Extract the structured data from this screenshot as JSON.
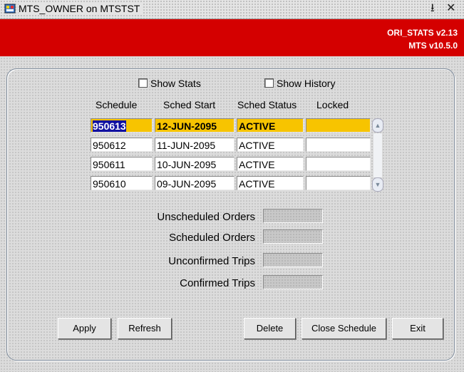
{
  "window": {
    "title": "MTS_OWNER on MTSTST",
    "controls": {
      "minimize": "⭳",
      "close": "✕"
    }
  },
  "header": {
    "version_primary": "ORI_STATS v2.13",
    "version_secondary": "MTS v10.5.0",
    "color": "#d40000"
  },
  "options": {
    "show_stats": {
      "label": "Show Stats",
      "checked": false
    },
    "show_history": {
      "label": "Show History",
      "checked": false
    }
  },
  "grid": {
    "columns": [
      "Schedule",
      "Sched Start",
      "Sched Status",
      "Locked"
    ],
    "rows": [
      {
        "schedule": "950613",
        "start": "12-JUN-2095",
        "status": "ACTIVE",
        "locked": "",
        "selected": true
      },
      {
        "schedule": "950612",
        "start": "11-JUN-2095",
        "status": "ACTIVE",
        "locked": ""
      },
      {
        "schedule": "950611",
        "start": "10-JUN-2095",
        "status": "ACTIVE",
        "locked": ""
      },
      {
        "schedule": "950610",
        "start": "09-JUN-2095",
        "status": "ACTIVE",
        "locked": ""
      }
    ],
    "highlight_color": "#f7c400"
  },
  "stats": {
    "unscheduled_orders": {
      "label": "Unscheduled Orders",
      "value": ""
    },
    "scheduled_orders": {
      "label": "Scheduled Orders",
      "value": ""
    },
    "unconfirmed_trips": {
      "label": "Unconfirmed Trips",
      "value": ""
    },
    "confirmed_trips": {
      "label": "Confirmed Trips",
      "value": ""
    }
  },
  "buttons": {
    "apply": "Apply",
    "refresh": "Refresh",
    "delete": "Delete",
    "close_schedule": "Close Schedule",
    "exit": "Exit"
  }
}
